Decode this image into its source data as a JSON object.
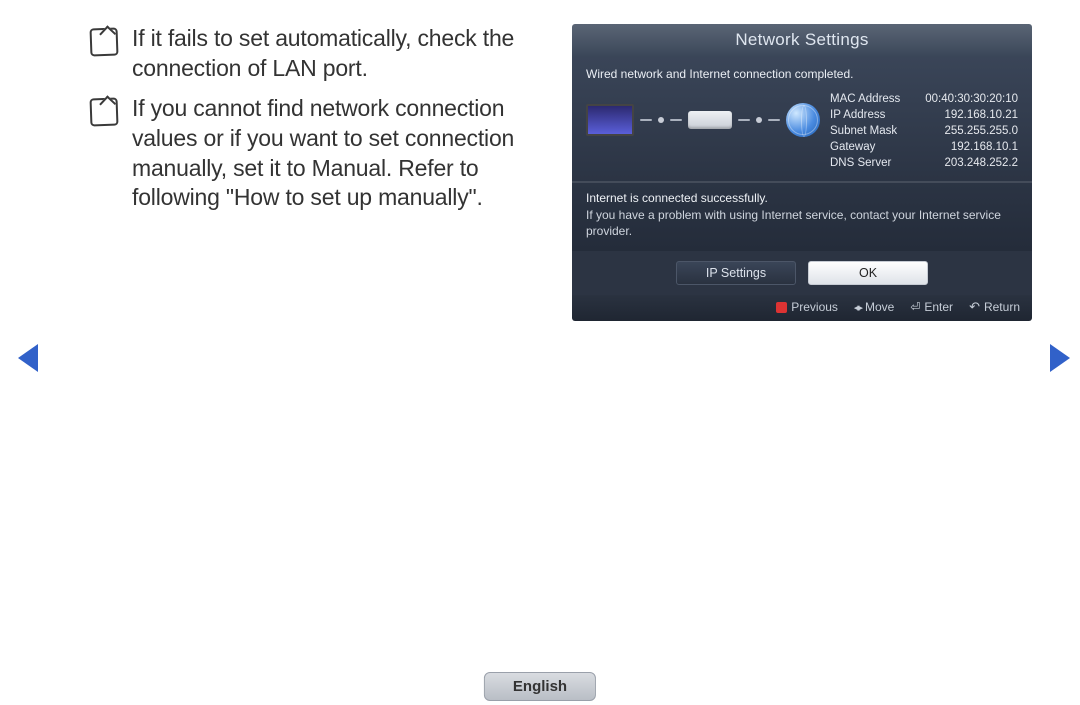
{
  "notes": [
    "If it fails to set automatically, check the connection of LAN port.",
    "If you cannot find network connection values or if you want to set connection manually, set it to Manual. Refer to following \"How to set up manually\"."
  ],
  "panel": {
    "title": "Network Settings",
    "status_top": "Wired network and Internet connection completed.",
    "net": {
      "mac": {
        "label": "MAC Address",
        "value": "00:40:30:30:20:10"
      },
      "ip": {
        "label": "IP Address",
        "value": "192.168.10.21"
      },
      "mask": {
        "label": "Subnet Mask",
        "value": "255.255.255.0"
      },
      "gw": {
        "label": "Gateway",
        "value": "192.168.10.1"
      },
      "dns": {
        "label": "DNS Server",
        "value": "203.248.252.2"
      }
    },
    "status_msg1": "Internet is connected successfully.",
    "status_msg2": "If you have a problem with using Internet service, contact your Internet service provider.",
    "buttons": {
      "ip_settings": "IP Settings",
      "ok": "OK"
    },
    "footer": {
      "previous": "Previous",
      "move": "Move",
      "enter": "Enter",
      "return": "Return"
    }
  },
  "language": "English"
}
